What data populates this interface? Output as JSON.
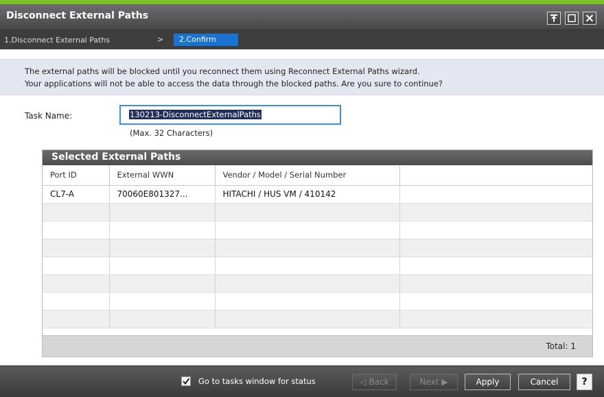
{
  "window": {
    "title": "Disconnect External Paths"
  },
  "breadcrumb": {
    "step1": "1.Disconnect External Paths",
    "separator": ">",
    "step2": "2.Confirm"
  },
  "info": {
    "line1": "The external paths will be blocked until you reconnect them using Reconnect External Paths wizard.",
    "line2": "Your applications will not be able to access the data through the blocked paths. Are you sure to continue?"
  },
  "task": {
    "label": "Task Name:",
    "value": "130213-DisconnectExternalPaths",
    "hint": "(Max. 32 Characters)"
  },
  "table": {
    "title": "Selected External Paths",
    "columns": [
      "Port ID",
      "External WWN",
      "Vendor / Model / Serial Number",
      ""
    ],
    "rows": [
      [
        "CL7-A",
        "70060E801327...",
        "HITACHI / HUS VM / 410142",
        ""
      ]
    ],
    "total": "Total:  1"
  },
  "footer": {
    "checkbox_label": "Go to tasks window for status",
    "checkbox_checked": true,
    "back": "Back",
    "next": "Next",
    "apply": "Apply",
    "cancel": "Cancel",
    "help": "?"
  }
}
